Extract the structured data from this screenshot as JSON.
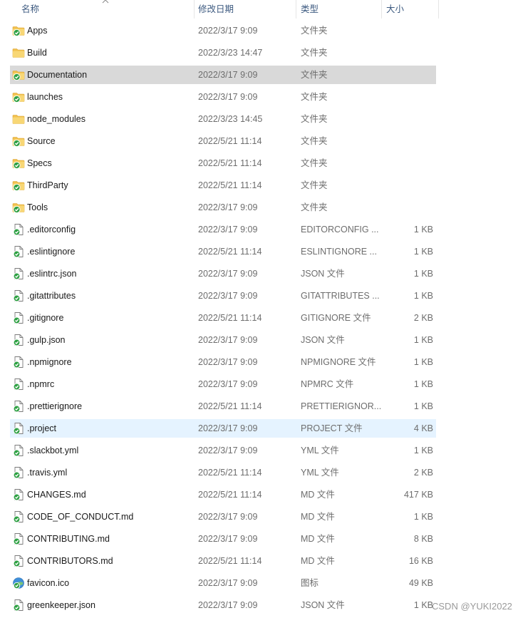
{
  "header": {
    "name": "名称",
    "date": "修改日期",
    "type": "类型",
    "size": "大小"
  },
  "files": [
    {
      "name": "Apps",
      "date": "2022/3/17 9:09",
      "type": "文件夹",
      "size": "",
      "icon": "folder-synced-icon"
    },
    {
      "name": "Build",
      "date": "2022/3/23 14:47",
      "type": "文件夹",
      "size": "",
      "icon": "folder-icon"
    },
    {
      "name": "Documentation",
      "date": "2022/3/17 9:09",
      "type": "文件夹",
      "size": "",
      "icon": "folder-synced-icon"
    },
    {
      "name": "launches",
      "date": "2022/3/17 9:09",
      "type": "文件夹",
      "size": "",
      "icon": "folder-synced-icon"
    },
    {
      "name": "node_modules",
      "date": "2022/3/23 14:45",
      "type": "文件夹",
      "size": "",
      "icon": "folder-icon"
    },
    {
      "name": "Source",
      "date": "2022/5/21 11:14",
      "type": "文件夹",
      "size": "",
      "icon": "folder-synced-icon"
    },
    {
      "name": "Specs",
      "date": "2022/5/21 11:14",
      "type": "文件夹",
      "size": "",
      "icon": "folder-synced-icon"
    },
    {
      "name": "ThirdParty",
      "date": "2022/5/21 11:14",
      "type": "文件夹",
      "size": "",
      "icon": "folder-synced-icon"
    },
    {
      "name": "Tools",
      "date": "2022/3/17 9:09",
      "type": "文件夹",
      "size": "",
      "icon": "folder-synced-icon"
    },
    {
      "name": ".editorconfig",
      "date": "2022/3/17 9:09",
      "type": "EDITORCONFIG ...",
      "size": "1 KB",
      "icon": "file-synced-icon"
    },
    {
      "name": ".eslintignore",
      "date": "2022/5/21 11:14",
      "type": "ESLINTIGNORE ...",
      "size": "1 KB",
      "icon": "file-synced-icon"
    },
    {
      "name": ".eslintrc.json",
      "date": "2022/3/17 9:09",
      "type": "JSON 文件",
      "size": "1 KB",
      "icon": "file-synced-icon"
    },
    {
      "name": ".gitattributes",
      "date": "2022/3/17 9:09",
      "type": "GITATTRIBUTES ...",
      "size": "1 KB",
      "icon": "file-synced-icon"
    },
    {
      "name": ".gitignore",
      "date": "2022/5/21 11:14",
      "type": "GITIGNORE 文件",
      "size": "2 KB",
      "icon": "file-synced-icon"
    },
    {
      "name": ".gulp.json",
      "date": "2022/3/17 9:09",
      "type": "JSON 文件",
      "size": "1 KB",
      "icon": "file-synced-icon"
    },
    {
      "name": ".npmignore",
      "date": "2022/3/17 9:09",
      "type": "NPMIGNORE 文件",
      "size": "1 KB",
      "icon": "file-synced-icon"
    },
    {
      "name": ".npmrc",
      "date": "2022/3/17 9:09",
      "type": "NPMRC 文件",
      "size": "1 KB",
      "icon": "file-synced-icon"
    },
    {
      "name": ".prettierignore",
      "date": "2022/5/21 11:14",
      "type": "PRETTIERIGNOR...",
      "size": "1 KB",
      "icon": "file-synced-icon"
    },
    {
      "name": ".project",
      "date": "2022/3/17 9:09",
      "type": "PROJECT 文件",
      "size": "4 KB",
      "icon": "file-synced-icon"
    },
    {
      "name": ".slackbot.yml",
      "date": "2022/3/17 9:09",
      "type": "YML 文件",
      "size": "1 KB",
      "icon": "file-synced-icon"
    },
    {
      "name": ".travis.yml",
      "date": "2022/5/21 11:14",
      "type": "YML 文件",
      "size": "2 KB",
      "icon": "file-synced-icon"
    },
    {
      "name": "CHANGES.md",
      "date": "2022/5/21 11:14",
      "type": "MD 文件",
      "size": "417 KB",
      "icon": "file-synced-icon"
    },
    {
      "name": "CODE_OF_CONDUCT.md",
      "date": "2022/3/17 9:09",
      "type": "MD 文件",
      "size": "1 KB",
      "icon": "file-synced-icon"
    },
    {
      "name": "CONTRIBUTING.md",
      "date": "2022/3/17 9:09",
      "type": "MD 文件",
      "size": "8 KB",
      "icon": "file-synced-icon"
    },
    {
      "name": "CONTRIBUTORS.md",
      "date": "2022/5/21 11:14",
      "type": "MD 文件",
      "size": "16 KB",
      "icon": "file-synced-icon"
    },
    {
      "name": "favicon.ico",
      "date": "2022/3/17 9:09",
      "type": "图标",
      "size": "49 KB",
      "icon": "image-file-icon"
    },
    {
      "name": "greenkeeper.json",
      "date": "2022/3/17 9:09",
      "type": "JSON 文件",
      "size": "1 KB",
      "icon": "file-synced-icon"
    }
  ],
  "selected_index": 2,
  "hover_index": 18,
  "watermark": "CSDN @YUKI2022",
  "colors": {
    "selected_bg": "#d9d9d9",
    "hover_bg": "#e5f3ff",
    "header_text": "#3d5a80",
    "sync_green": "#2ea043"
  }
}
